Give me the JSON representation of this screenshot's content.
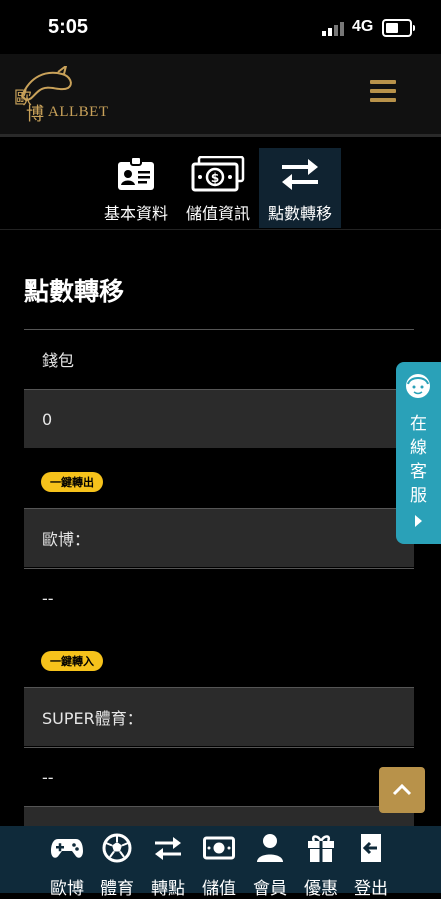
{
  "status_bar": {
    "time": "5:05",
    "network": "4G"
  },
  "header": {
    "logo": {
      "cn_line1": "歐",
      "cn_line2": "博",
      "en": "ALLBET"
    }
  },
  "tabs": [
    {
      "label": "基本資料",
      "icon": "id-card-icon",
      "active": false
    },
    {
      "label": "儲值資訊",
      "icon": "money-icon",
      "active": false
    },
    {
      "label": "點數轉移",
      "icon": "transfer-icon",
      "active": true
    }
  ],
  "page": {
    "title": "點數轉移",
    "wallet_label": "錢包",
    "wallet_value": "0",
    "transfer_out_badge": "一鍵轉出",
    "allbet_label": "歐博：",
    "allbet_value": "--",
    "transfer_in_badge": "一鍵轉入",
    "super_label": "SUPER體育：",
    "super_value": "--"
  },
  "support": {
    "label_chars": [
      "在",
      "線",
      "客",
      "服"
    ]
  },
  "bottom_nav": [
    {
      "label": "歐博",
      "icon": "gamepad-icon"
    },
    {
      "label": "體育",
      "icon": "soccer-ball-icon"
    },
    {
      "label": "轉點",
      "icon": "transfer-icon"
    },
    {
      "label": "儲值",
      "icon": "cash-icon"
    },
    {
      "label": "會員",
      "icon": "user-icon"
    },
    {
      "label": "優惠",
      "icon": "gift-icon"
    },
    {
      "label": "登出",
      "icon": "logout-icon"
    }
  ],
  "colors": {
    "accent_gold": "#b8924a",
    "badge_yellow": "#f6c21b",
    "support_teal": "#2aa1b8",
    "nav_bg": "#0f2a3a"
  }
}
